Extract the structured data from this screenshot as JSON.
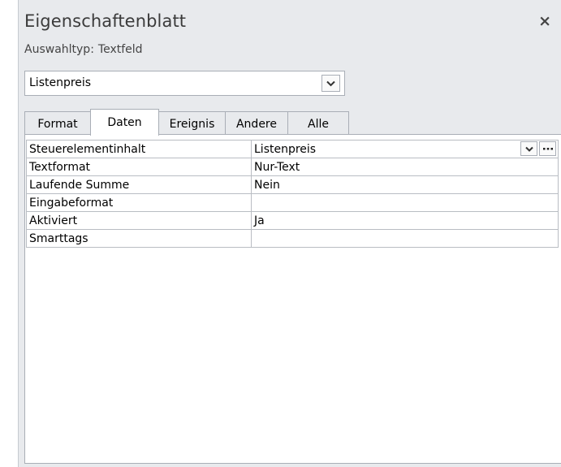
{
  "pane": {
    "title": "Eigenschaftenblatt",
    "close_glyph": "×",
    "selection_type_label": "Auswahltyp:",
    "selection_type_value": "Textfeld",
    "object_combo_value": "Listenpreis"
  },
  "tabs": [
    {
      "label": "Format",
      "active": false
    },
    {
      "label": "Daten",
      "active": true
    },
    {
      "label": "Ereignis",
      "active": false
    },
    {
      "label": "Andere",
      "active": false
    },
    {
      "label": "Alle",
      "active": false
    }
  ],
  "properties": [
    {
      "name": "Steuerelementinhalt",
      "value": "Listenpreis"
    },
    {
      "name": "Textformat",
      "value": "Nur-Text"
    },
    {
      "name": "Laufende Summe",
      "value": "Nein"
    },
    {
      "name": "Eingabeformat",
      "value": ""
    },
    {
      "name": "Aktiviert",
      "value": "Ja"
    },
    {
      "name": "Smarttags",
      "value": ""
    }
  ],
  "icons": {
    "combo_dropdown": "chevron-down-icon",
    "row_dropdown": "chevron-down-icon",
    "row_builder": "ellipsis-icon",
    "close": "close-icon"
  }
}
